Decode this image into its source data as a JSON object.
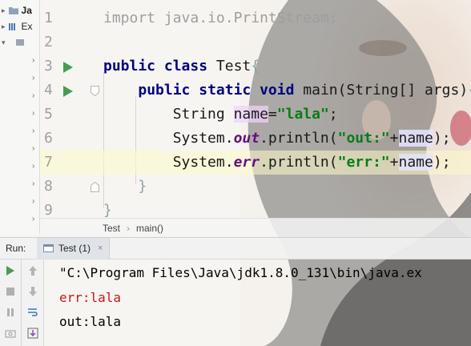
{
  "project": {
    "rows": [
      {
        "label": "Ja",
        "icon": "folder-icon"
      },
      {
        "label": "Ex",
        "icon": "library-icon"
      },
      {
        "label": "",
        "icon": "package-icon"
      }
    ]
  },
  "editor": {
    "line_numbers": [
      "1",
      "2",
      "3",
      "4",
      "5",
      "6",
      "7",
      "8",
      "9"
    ],
    "tokens": {
      "import_kw": "import",
      "import_path": " java.io.PrintStream;",
      "public1": "public",
      "class_kw": " class",
      "class_name": " Test",
      "brace_open": "{",
      "public2": "public",
      "static_kw": " static",
      "void_kw": " void",
      "main_sig": " main(String[] args)",
      "brace_open2": "{",
      "string_type": "String ",
      "name_var": "name",
      "assign": "=",
      "lala_str": "\"lala\"",
      "semi": ";",
      "sys1": "System.",
      "out_field": "out",
      "println1": ".println(",
      "out_str": "\"out:\"",
      "plus1": "+",
      "name_ref1": "name",
      "close1": ");",
      "sys2": "System.",
      "err_field": "err",
      "println2": ".println(",
      "err_str": "\"err:\"",
      "plus2": "+",
      "name_ref2": "name",
      "close2": ");",
      "brace_close_inner": "}",
      "brace_close_outer": "}"
    }
  },
  "breadcrumb": {
    "class": "Test",
    "separator": "›",
    "method": "main()"
  },
  "run_window": {
    "label": "Run:",
    "tab_label": "Test (1)",
    "tab_close": "×",
    "console_lines": [
      {
        "text": "\"C:\\Program Files\\Java\\jdk1.8.0_131\\bin\\java.ex",
        "color": "#1a1a1a"
      },
      {
        "text": "err:lala",
        "color": "#c41a16"
      },
      {
        "text": "out:lala",
        "color": "#1a1a1a"
      }
    ]
  },
  "colors": {
    "run_green": "#499c54",
    "keyword": "#00007f",
    "string": "#067d17",
    "field": "#660e7a",
    "error_text": "#c41a16"
  }
}
